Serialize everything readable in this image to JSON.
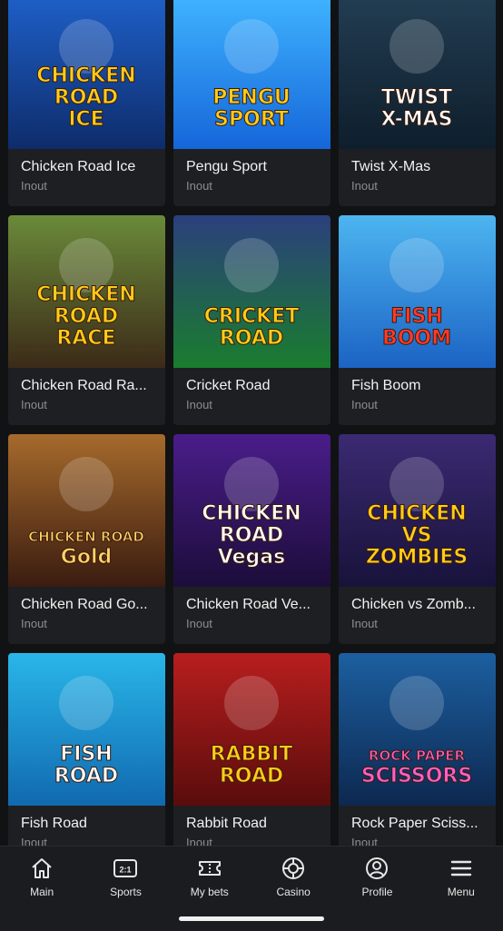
{
  "games": [
    {
      "title": "Chicken Road Ice",
      "provider": "Inout",
      "logo_lines": [
        "CHICKEN",
        "ROAD",
        "ICE"
      ],
      "colors": [
        "#1e5fc7",
        "#0e2c6b"
      ],
      "accent": "#ffcc1a"
    },
    {
      "title": "Pengu Sport",
      "provider": "Inout",
      "logo_lines": [
        "PENGU",
        "SPORT"
      ],
      "colors": [
        "#3fb3ff",
        "#1566d9"
      ],
      "accent": "#ffcc1a"
    },
    {
      "title": "Twist X-Mas",
      "provider": "Inout",
      "logo_lines": [
        "TWIST",
        "X-MAS"
      ],
      "colors": [
        "#223d52",
        "#0e1e2c"
      ],
      "accent": "#ffffff"
    },
    {
      "title": "Chicken Road Ra...",
      "provider": "Inout",
      "logo_lines": [
        "CHICKEN",
        "ROAD",
        "RACE"
      ],
      "colors": [
        "#6a8a3a",
        "#3c2a18"
      ],
      "accent": "#ffcc1a"
    },
    {
      "title": "Cricket Road",
      "provider": "Inout",
      "logo_lines": [
        "CRICKET",
        "ROAD"
      ],
      "colors": [
        "#2b3f7d",
        "#1a7d2e"
      ],
      "accent": "#ffcc1a"
    },
    {
      "title": "Fish Boom",
      "provider": "Inout",
      "logo_lines": [
        "FISH",
        "BOOM"
      ],
      "colors": [
        "#4db5f0",
        "#1b63c4"
      ],
      "accent": "#ff3a2a"
    },
    {
      "title": "Chicken Road Go...",
      "provider": "Inout",
      "logo_lines": [
        "CHICKEN ROAD",
        "Gold"
      ],
      "colors": [
        "#a66a2c",
        "#3a1c10"
      ],
      "accent": "#ffd46a"
    },
    {
      "title": "Chicken Road Ve...",
      "provider": "Inout",
      "logo_lines": [
        "CHICKEN",
        "ROAD",
        "Vegas"
      ],
      "colors": [
        "#4a1d8a",
        "#1c0d3a"
      ],
      "accent": "#ffffff"
    },
    {
      "title": "Chicken vs Zomb...",
      "provider": "Inout",
      "logo_lines": [
        "CHICKEN",
        "VS",
        "ZOMBIES"
      ],
      "colors": [
        "#3b2a72",
        "#18123a"
      ],
      "accent": "#ffcc1a"
    },
    {
      "title": "Fish Road",
      "provider": "Inout",
      "logo_lines": [
        "FISH",
        "ROAD"
      ],
      "colors": [
        "#29b6e8",
        "#1169b0"
      ],
      "accent": "#ffffff"
    },
    {
      "title": "Rabbit Road",
      "provider": "Inout",
      "logo_lines": [
        "RABBIT",
        "ROAD"
      ],
      "colors": [
        "#b81e1e",
        "#5a0c0c"
      ],
      "accent": "#ffcc1a"
    },
    {
      "title": "Rock Paper Sciss...",
      "provider": "Inout",
      "logo_lines": [
        "ROCK PAPER",
        "SCISSORS"
      ],
      "colors": [
        "#1c5fa0",
        "#0d2850"
      ],
      "accent": "#ff5ec8"
    }
  ],
  "nav": [
    {
      "label": "Main",
      "icon": "home-icon"
    },
    {
      "label": "Sports",
      "icon": "sports-icon",
      "icon_text": "2:1"
    },
    {
      "label": "My bets",
      "icon": "ticket-icon"
    },
    {
      "label": "Casino",
      "icon": "casino-chip-icon"
    },
    {
      "label": "Profile",
      "icon": "profile-icon"
    },
    {
      "label": "Menu",
      "icon": "menu-icon"
    }
  ]
}
